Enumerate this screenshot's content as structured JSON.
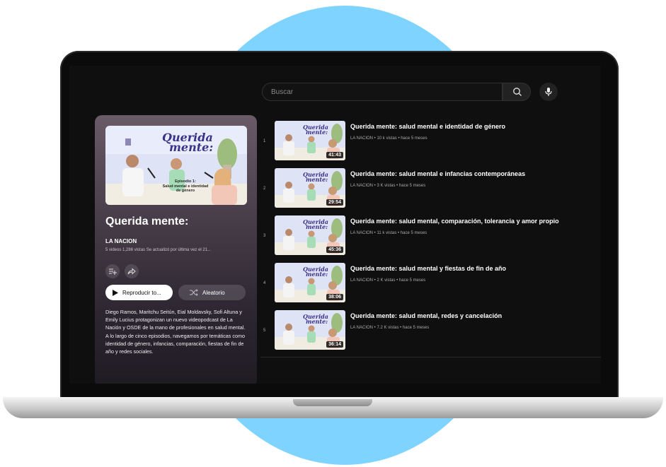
{
  "search": {
    "placeholder": "Buscar"
  },
  "playlist": {
    "title": "Querida mente:",
    "channel": "LA NACION",
    "stats": "5 videos  1,286 vistas  Se actualizó por última vez el 21...",
    "play_label": "Reproducir to...",
    "shuffle_label": "Aleatorio",
    "description": "Diego Ramos, Maritchu Seitún, Eial Moldavsky, Sofi Altuna y Emily Lucius protagonizan un nuevo videopodcast de La Nación y OSDE de la mano de profesionales en salud mental. A lo largo de cinco episodios, navegamos por temáticas como identidad de género, infancias, comparación, fiestas de fin de año y redes sociales.",
    "thumb": {
      "title_line1": "Querida",
      "title_line2": "mente:",
      "episode_label": "Episodio 1:",
      "episode_title": "Salud mental e identidad de género"
    }
  },
  "videos": [
    {
      "index": "1",
      "title": "Querida mente: salud mental e identidad de género",
      "meta": "LA NACION • 10 k vistas • hace 5 meses",
      "duration": "41:43"
    },
    {
      "index": "2",
      "title": "Querida mente: salud mental e infancias contemporáneas",
      "meta": "LA NACION • 3 K vistas • hace 5 meses",
      "duration": "29:54"
    },
    {
      "index": "3",
      "title": "Querida mente: salud mental, comparación, tolerancia y amor propio",
      "meta": "LA NACION • 11 k vistas • hace 5 meses",
      "duration": "45:36"
    },
    {
      "index": "4",
      "title": "Querida mente: salud mental y fiestas de fin de año",
      "meta": "LA NACION • 2 K vistas • hace 5 meses",
      "duration": "38:06"
    },
    {
      "index": "5",
      "title": "Querida mente: salud mental, redes y cancelación",
      "meta": "LA NACION • 7.2 K vistas • hace 5 meses",
      "duration": "36:14"
    }
  ],
  "colors": {
    "accent_bg": "#7fd3ff",
    "screen_bg": "#0f0f0f",
    "thumb_bg": "#dfe3f6"
  }
}
